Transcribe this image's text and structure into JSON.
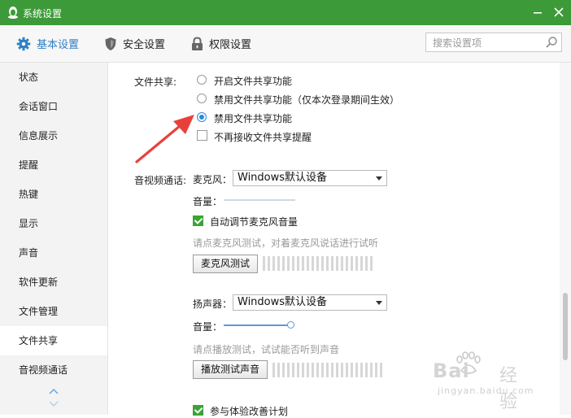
{
  "window": {
    "title": "系统设置"
  },
  "tabs": [
    {
      "label": "基本设置",
      "icon": "gear-icon",
      "active": true
    },
    {
      "label": "安全设置",
      "icon": "shield-icon",
      "active": false
    },
    {
      "label": "权限设置",
      "icon": "lock-icon",
      "active": false
    }
  ],
  "search": {
    "placeholder": "搜索设置项",
    "value": ""
  },
  "sidebar": {
    "items": [
      {
        "label": "状态"
      },
      {
        "label": "会话窗口"
      },
      {
        "label": "信息展示"
      },
      {
        "label": "提醒"
      },
      {
        "label": "热键"
      },
      {
        "label": "显示"
      },
      {
        "label": "声音"
      },
      {
        "label": "软件更新"
      },
      {
        "label": "文件管理"
      },
      {
        "label": "文件共享",
        "active": true
      },
      {
        "label": "音视频通话"
      }
    ]
  },
  "file_share": {
    "section_label": "文件共享:",
    "options": [
      {
        "label": "开启文件共享功能",
        "selected": false
      },
      {
        "label": "禁用文件共享功能（仅本次登录期间生效）",
        "selected": false
      },
      {
        "label": "禁用文件共享功能",
        "selected": true
      }
    ],
    "no_reminder": {
      "label": "不再接收文件共享提醒",
      "checked": false
    }
  },
  "av_call": {
    "section_label": "音视频通话:",
    "mic": {
      "label": "麦克风：",
      "device": "Windows默认设备",
      "volume_label": "音量：",
      "volume_fraction": 0.0,
      "auto_adjust": {
        "label": "自动调节麦克风音量",
        "checked": true
      },
      "hint": "请点麦克风测试，对着麦克风说话进行试听",
      "test_button": "麦克风测试"
    },
    "speaker": {
      "label": "扬声器：",
      "device": "Windows默认设备",
      "volume_label": "音量：",
      "volume_fraction": 1.0,
      "hint": "请点播放测试，试试能否听到声音",
      "test_button": "播放测试声音"
    },
    "experience": {
      "label": "参与体验改善计划",
      "checked": true
    }
  },
  "watermark": {
    "brand": "Bai",
    "brand2": "经验",
    "url": "jingyan.baidu.com"
  },
  "colors": {
    "titlebar": "#3d9a39",
    "accent": "#2b8ad8",
    "check": "#3aa435",
    "arrow": "#e8413c"
  }
}
